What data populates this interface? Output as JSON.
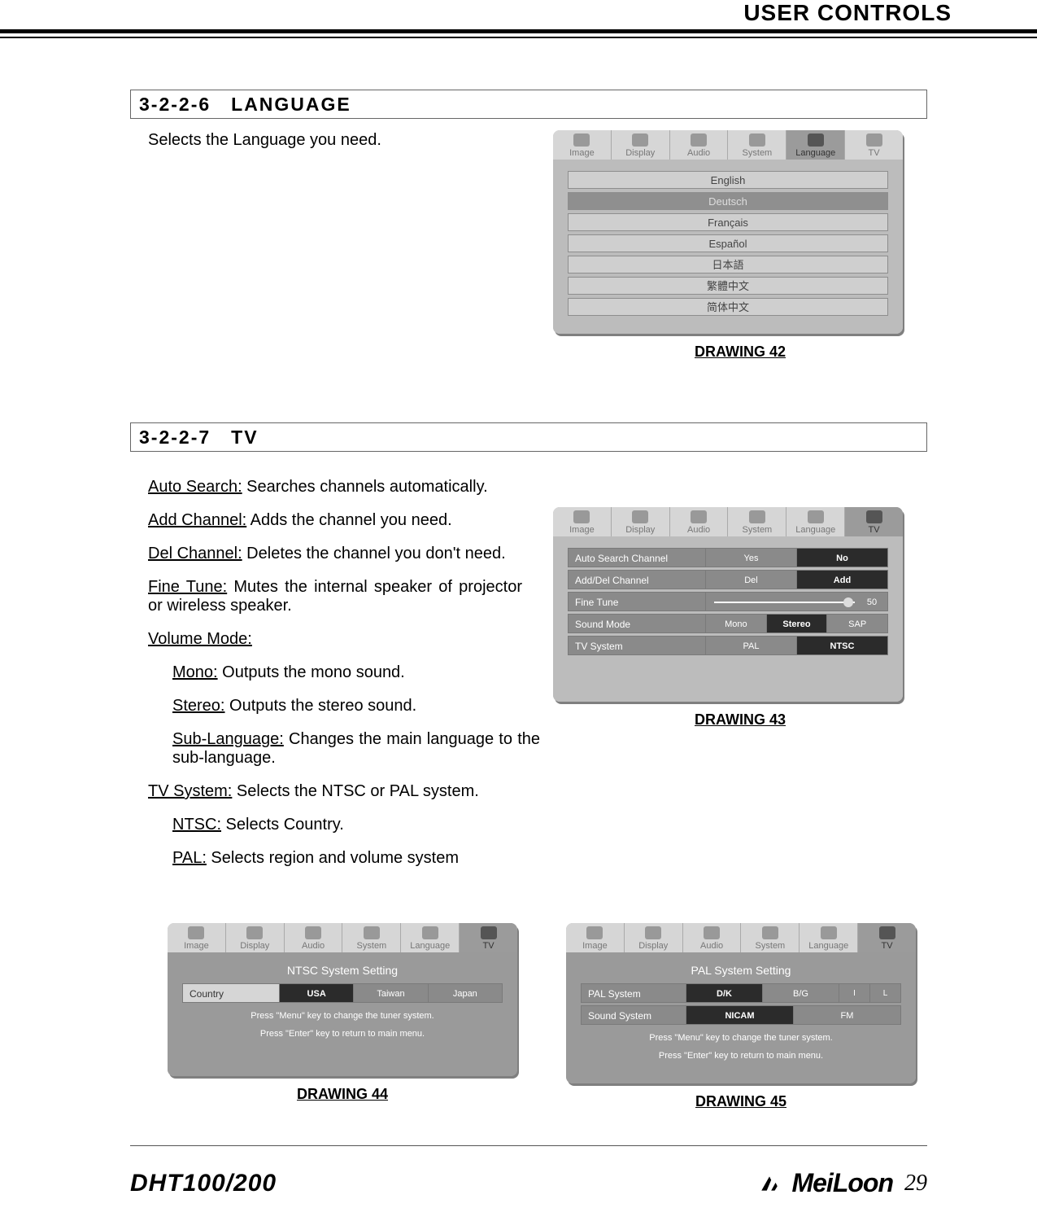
{
  "header": {
    "title": "USER CONTROLS"
  },
  "sect_lang": {
    "heading": "3-2-2-6 LANGUAGE",
    "desc": "Selects the Language you need.",
    "caption": "DRAWING 42"
  },
  "osd_tabs": {
    "t0": "Image",
    "t1": "Display",
    "t2": "Audio",
    "t3": "System",
    "t4": "Language",
    "t5": "TV"
  },
  "lang_opts": {
    "l0": "English",
    "l1": "Deutsch",
    "l2": "Français",
    "l3": "Español",
    "l4": "日本語",
    "l5": "繁體中文",
    "l6": "简体中文"
  },
  "sect_tv": {
    "heading": "3-2-2-7 TV",
    "caption43": "DRAWING 43",
    "caption44": "DRAWING 44",
    "caption45": "DRAWING 45"
  },
  "tv": {
    "auto_lab": "Auto Search:",
    "auto_txt": " Searches channels automatically.",
    "add_lab": "Add Channel:",
    "add_txt": " Adds the channel you need.",
    "del_lab": "Del Channel:",
    "del_txt": " Deletes the channel you don't need.",
    "ft_lab": "Fine Tune:",
    "ft_txt": " Mutes the internal speaker of projector or wireless speaker.",
    "vm_lab": "Volume Mode:",
    "mono_lab": "Mono:",
    "mono_txt": " Outputs the mono sound.",
    "st_lab": "Stereo:",
    "st_txt": " Outputs the stereo sound.",
    "sub_lab": "Sub-Language:",
    "sub_txt": " Changes the main language to the sub-language.",
    "sys_lab": "TV System:",
    "sys_txt": " Selects the NTSC or PAL system.",
    "ntsc_lab": "NTSC:",
    "ntsc_txt": " Selects Country.",
    "pal_lab": "PAL:",
    "pal_txt": " Selects region and volume system"
  },
  "osd_tv": {
    "r0": "Auto Search Channel",
    "r0a": "Yes",
    "r0b": "No",
    "r1": "Add/Del Channel",
    "r1a": "Del",
    "r1b": "Add",
    "r2": "Fine Tune",
    "r2v": "50",
    "r3": "Sound Mode",
    "r3a": "Mono",
    "r3b": "Stereo",
    "r3c": "SAP",
    "r4": "TV System",
    "r4a": "PAL",
    "r4b": "NTSC"
  },
  "osd_ntsc": {
    "title": "NTSC System Setting",
    "lab": "Country",
    "o0": "USA",
    "o1": "Taiwan",
    "o2": "Japan",
    "h1": "Press \"Menu\" key to change the tuner system.",
    "h2": "Press \"Enter\" key to return to main menu."
  },
  "osd_pal": {
    "title": "PAL System Setting",
    "r0": "PAL System",
    "r0a": "D/K",
    "r0b": "B/G",
    "r0c": "I",
    "r0d": "L",
    "r1": "Sound System",
    "r1a": "NICAM",
    "r1b": "FM",
    "h1": "Press \"Menu\" key to change the tuner system.",
    "h2": "Press \"Enter\" key to return to main menu."
  },
  "footer": {
    "model": "DHT100/200",
    "logo": "MeiLoon",
    "page": "29"
  }
}
